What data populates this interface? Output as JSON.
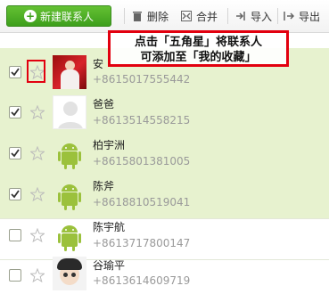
{
  "toolbar": {
    "new_contact_label": "新建联系人",
    "delete_label": "删除",
    "merge_label": "合并",
    "import_label": "导入",
    "export_label": "导出"
  },
  "annotation": {
    "line1": "点击「五角星」将联系人",
    "line2": "可添加至「我的收藏」"
  },
  "contacts": [
    {
      "name": "安",
      "phone": "+8615017555442",
      "checked": true,
      "avatar": "photo-red"
    },
    {
      "name": "爸爸",
      "phone": "+8613514558215",
      "checked": true,
      "avatar": "default-silhouette"
    },
    {
      "name": "柏宇洲",
      "phone": "+8615801381005",
      "checked": true,
      "avatar": "android-robot"
    },
    {
      "name": "陈斧",
      "phone": "+8618810519041",
      "checked": true,
      "avatar": "android-robot"
    },
    {
      "name": "陈宇航",
      "phone": "+8613717800147",
      "checked": false,
      "avatar": "android-robot"
    },
    {
      "name": "谷瑜平",
      "phone": "+8613614609719",
      "checked": false,
      "avatar": "cartoon-portrait"
    }
  ],
  "colors": {
    "selected_row": "#e7f2cf",
    "new_button": "#4caf28",
    "highlight": "#e2000f"
  }
}
